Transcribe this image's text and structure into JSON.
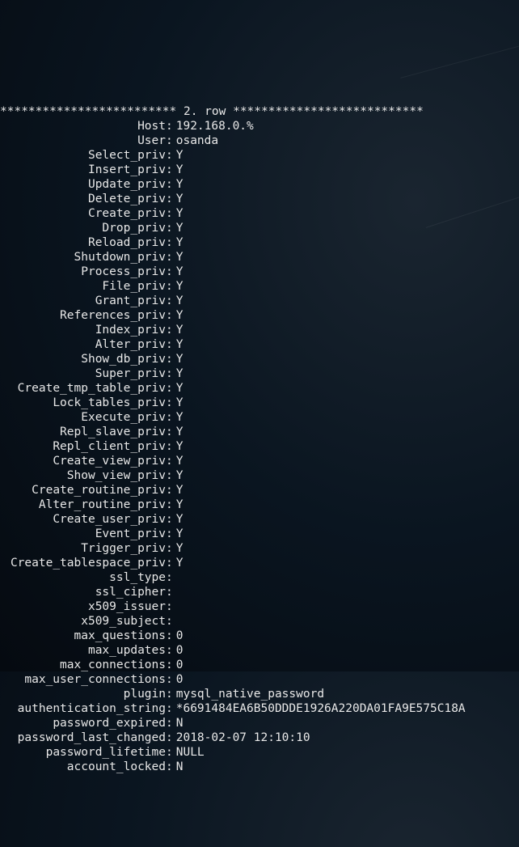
{
  "header": {
    "stars_left": "*************************",
    "row_label": " 2. row ",
    "stars_right": "***************************"
  },
  "fields": [
    {
      "key": "Host",
      "value": "192.168.0.%"
    },
    {
      "key": "User",
      "value": "osanda"
    },
    {
      "key": "Select_priv",
      "value": "Y"
    },
    {
      "key": "Insert_priv",
      "value": "Y"
    },
    {
      "key": "Update_priv",
      "value": "Y"
    },
    {
      "key": "Delete_priv",
      "value": "Y"
    },
    {
      "key": "Create_priv",
      "value": "Y"
    },
    {
      "key": "Drop_priv",
      "value": "Y"
    },
    {
      "key": "Reload_priv",
      "value": "Y"
    },
    {
      "key": "Shutdown_priv",
      "value": "Y"
    },
    {
      "key": "Process_priv",
      "value": "Y"
    },
    {
      "key": "File_priv",
      "value": "Y"
    },
    {
      "key": "Grant_priv",
      "value": "Y"
    },
    {
      "key": "References_priv",
      "value": "Y"
    },
    {
      "key": "Index_priv",
      "value": "Y"
    },
    {
      "key": "Alter_priv",
      "value": "Y"
    },
    {
      "key": "Show_db_priv",
      "value": "Y"
    },
    {
      "key": "Super_priv",
      "value": "Y"
    },
    {
      "key": "Create_tmp_table_priv",
      "value": "Y"
    },
    {
      "key": "Lock_tables_priv",
      "value": "Y"
    },
    {
      "key": "Execute_priv",
      "value": "Y"
    },
    {
      "key": "Repl_slave_priv",
      "value": "Y"
    },
    {
      "key": "Repl_client_priv",
      "value": "Y"
    },
    {
      "key": "Create_view_priv",
      "value": "Y"
    },
    {
      "key": "Show_view_priv",
      "value": "Y"
    },
    {
      "key": "Create_routine_priv",
      "value": "Y"
    },
    {
      "key": "Alter_routine_priv",
      "value": "Y"
    },
    {
      "key": "Create_user_priv",
      "value": "Y"
    },
    {
      "key": "Event_priv",
      "value": "Y"
    },
    {
      "key": "Trigger_priv",
      "value": "Y"
    },
    {
      "key": "Create_tablespace_priv",
      "value": "Y"
    },
    {
      "key": "ssl_type",
      "value": ""
    },
    {
      "key": "ssl_cipher",
      "value": ""
    },
    {
      "key": "x509_issuer",
      "value": ""
    },
    {
      "key": "x509_subject",
      "value": ""
    },
    {
      "key": "max_questions",
      "value": "0"
    },
    {
      "key": "max_updates",
      "value": "0"
    },
    {
      "key": "max_connections",
      "value": "0"
    },
    {
      "key": "max_user_connections",
      "value": "0"
    },
    {
      "key": "plugin",
      "value": "mysql_native_password"
    },
    {
      "key": "authentication_string",
      "value": "*6691484EA6B50DDDE1926A220DA01FA9E575C18A"
    },
    {
      "key": "password_expired",
      "value": "N"
    },
    {
      "key": "password_last_changed",
      "value": "2018-02-07 12:10:10"
    },
    {
      "key": "password_lifetime",
      "value": "NULL"
    },
    {
      "key": "account_locked",
      "value": "N"
    }
  ]
}
